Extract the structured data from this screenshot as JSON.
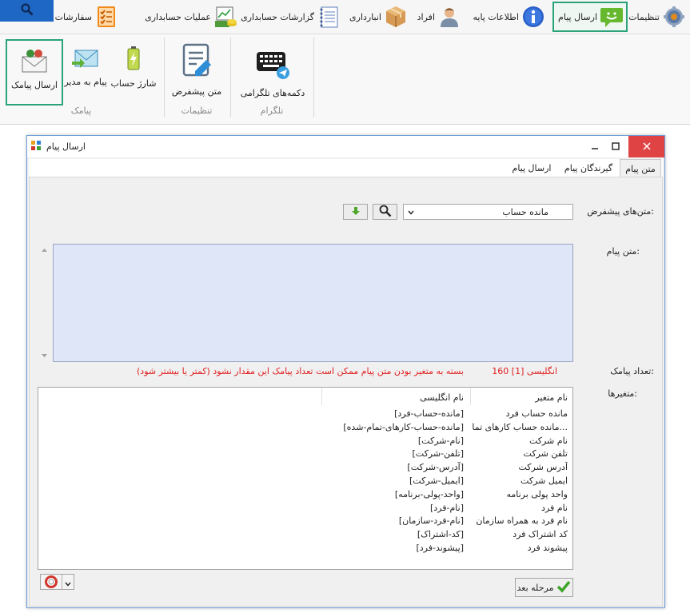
{
  "menubar": {
    "items": [
      {
        "label": "تنظیمات",
        "icon": "gear-icon"
      },
      {
        "label": "ارسال پیام",
        "icon": "smiley-message-icon",
        "active": true
      },
      {
        "label": "اطلاعات پایه",
        "icon": "info-icon"
      },
      {
        "label": "افراد",
        "icon": "person-icon"
      },
      {
        "label": "انبارداری",
        "icon": "box-icon"
      },
      {
        "label": "گزارشات حسابداری",
        "icon": "notebook-icon"
      },
      {
        "label": "عملیات حسابداری",
        "icon": "cash-chart-icon"
      },
      {
        "label": "سفارشات",
        "icon": "checklist-icon"
      }
    ],
    "search_icon": "search-icon"
  },
  "ribbon": {
    "groups": [
      {
        "caption": "پیامک",
        "buttons": [
          {
            "label": "ارسال پیامک",
            "icon": "sms-envelope-icon",
            "active": true
          },
          {
            "label": "پیام به مدیر",
            "icon": "email-envelope-icon"
          },
          {
            "label": "شارژ حساب",
            "icon": "battery-icon"
          }
        ]
      },
      {
        "caption": "تنظیمات",
        "buttons": [
          {
            "label": "متن پیشفرض",
            "icon": "document-pen-icon"
          }
        ]
      },
      {
        "caption": "تلگرام",
        "buttons": [
          {
            "label": "دکمه‌های تلگرامی",
            "icon": "telegram-keyboard-icon"
          }
        ]
      }
    ]
  },
  "dialog": {
    "title": "ارسال پیام",
    "tabs": [
      "متن پیام",
      "گیرندگان پیام",
      "ارسال پیام"
    ],
    "template_label": "متن‌های پیشفرض:",
    "template_value": "مانده حساب",
    "message_label": "متن پیام:",
    "message_value": "",
    "sms_count_label": "تعداد پیامک:",
    "sms_count_value": "160 [1] انگلیسی",
    "warning_text": "بسته به متغیر بودن متن پیام ممکن است تعداد پیامک این مقدار نشود (کمتر یا بیشتر شود)",
    "variables_label": "متغیرها:",
    "variables": {
      "headers": [
        "نام متغیر",
        "نام انگلیسی"
      ],
      "rows": [
        [
          "مانده حساب فرد",
          "[مانده-حساب-فرد]"
        ],
        [
          "مانده حساب کارهای تما...",
          "[مانده-حساب-کارهای-تمام-شده]"
        ],
        [
          "نام شرکت",
          "[نام-شرکت]"
        ],
        [
          "تلفن شرکت",
          "[تلفن-شرکت]"
        ],
        [
          "آدرس شرکت",
          "[آدرس-شرکت]"
        ],
        [
          "ایمیل شرکت",
          "[ایمیل-شرکت]"
        ],
        [
          "واحد پولی برنامه",
          "[واحد-پولی-برنامه]"
        ],
        [
          "نام فرد",
          "[نام-فرد]"
        ],
        [
          "نام فرد به همراه سازمان",
          "[نام-فرد-سازمان]"
        ],
        [
          "کد اشتراک فرد",
          "[کد-اشتراک]"
        ],
        [
          "پیشوند فرد",
          "[پیشوند-فرد]"
        ]
      ]
    },
    "next_button": "مرحله بعد"
  },
  "colors": {
    "active_border": "#2aa37a",
    "search_tab": "#1f67c4",
    "close_button": "#e04343",
    "message_bg": "#dfe6f7",
    "warning_red": "#e01e1e"
  }
}
